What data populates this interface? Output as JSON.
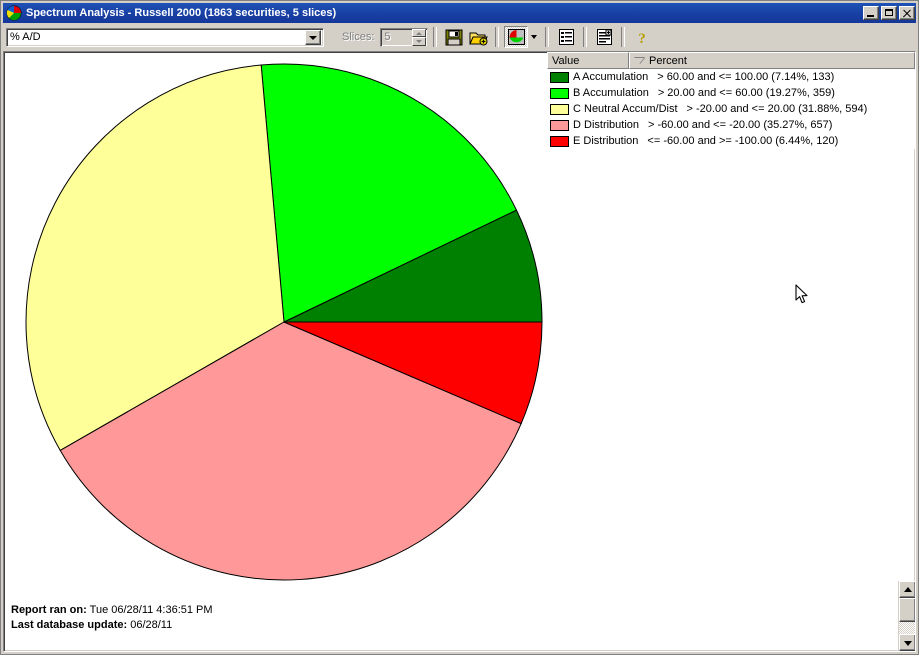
{
  "window": {
    "title": "Spectrum Analysis - Russell 2000 (1863 securities, 5 slices)",
    "icon": "pie-chart-icon",
    "minimize_label": "_",
    "maximize_label": "□",
    "close_label": "✕"
  },
  "toolbar": {
    "mode_combo": {
      "value": "% A/D",
      "icon": "chevron-down-icon"
    },
    "slices": {
      "label": "Slices:",
      "value": "5"
    },
    "buttons": [
      {
        "name": "save-button",
        "icon": "floppy-disk-icon"
      },
      {
        "name": "open-button",
        "icon": "open-folder-add-icon"
      },
      {
        "name": "chart-type-button",
        "icon": "pie-chart-icon"
      },
      {
        "name": "chart-type-dropdown",
        "icon": "chevron-down-icon"
      },
      {
        "name": "list-view-button",
        "icon": "list-icon"
      },
      {
        "name": "report-view-button",
        "icon": "report-icon"
      },
      {
        "name": "help-button",
        "icon": "question-mark-icon"
      }
    ]
  },
  "legend": {
    "columns": [
      {
        "label": "Value"
      },
      {
        "label": "Percent",
        "sort_indicator": "descending"
      }
    ],
    "rows": [
      {
        "color": "#008000",
        "label": "A Accumulation",
        "range": "> 60.00 and <= 100.00 (7.14%, 133)"
      },
      {
        "color": "#00ff00",
        "label": "B Accumulation",
        "range": "> 20.00 and <= 60.00 (19.27%, 359)"
      },
      {
        "color": "#ffff99",
        "label": "C Neutral Accum/Dist",
        "range": "> -20.00 and <= 20.00 (31.88%, 594)"
      },
      {
        "color": "#ff9999",
        "label": "D Distribution",
        "range": "> -60.00 and <= -20.00 (35.27%, 657)"
      },
      {
        "color": "#ff0000",
        "label": "E Distribution",
        "range": "<= -60.00 and >= -100.00 (6.44%, 120)"
      }
    ]
  },
  "footer": {
    "report_ran_label": "Report ran on:",
    "report_ran_value": "Tue 06/28/11 4:36:51 PM",
    "last_update_label": "Last database update:",
    "last_update_value": "06/28/11"
  },
  "chart_data": {
    "type": "pie",
    "title": "Spectrum Analysis - Russell 2000",
    "total_securities": 1863,
    "slice_count": 5,
    "start_angle_deg": 0,
    "direction": "counterclockwise",
    "categories": [
      "A Accumulation",
      "B Accumulation",
      "C Neutral Accum/Dist",
      "D Distribution",
      "E Distribution"
    ],
    "values": [
      7.14,
      19.27,
      31.88,
      35.27,
      6.44
    ],
    "counts": [
      133,
      359,
      594,
      657,
      120
    ],
    "colors": [
      "#008000",
      "#00ff00",
      "#ffff99",
      "#ff9999",
      "#ff0000"
    ],
    "ranges": [
      "> 60.00 and <= 100.00",
      "> 20.00 and <= 60.00",
      "> -20.00 and <= 20.00",
      "> -60.00 and <= -20.00",
      "<= -60.00 and >= -100.00"
    ],
    "xlabel": "",
    "ylabel": "Percent",
    "legend_position": "right"
  }
}
